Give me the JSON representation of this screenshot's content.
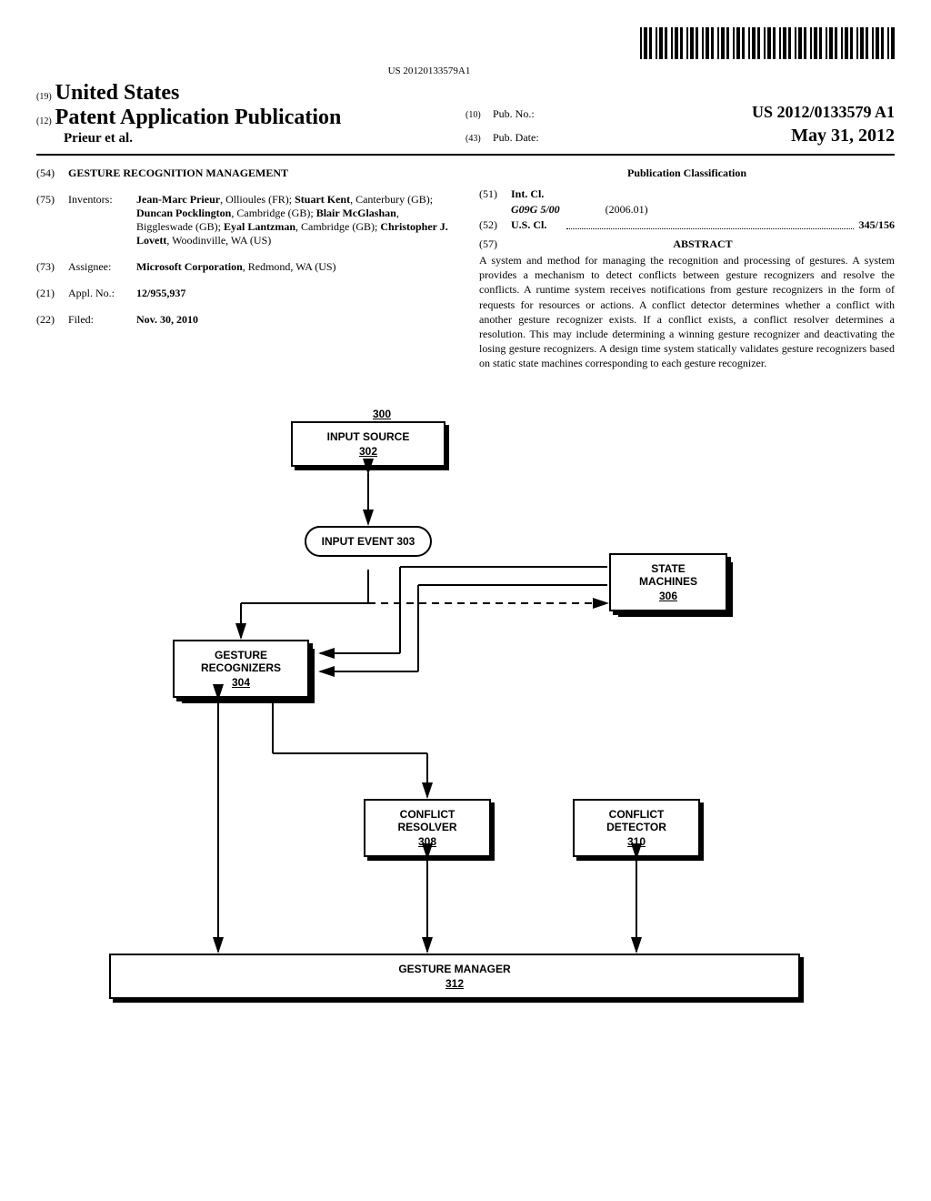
{
  "barcode_text": "US 20120133579A1",
  "header": {
    "num19": "(19)",
    "country": "United States",
    "num12": "(12)",
    "pub_type_label": "Patent Application Publication",
    "author_line": "Prieur et al.",
    "num10": "(10)",
    "pub_no_label": "Pub. No.:",
    "pub_no": "US 2012/0133579 A1",
    "num43": "(43)",
    "pub_date_label": "Pub. Date:",
    "pub_date": "May 31, 2012"
  },
  "biblio": {
    "num54": "(54)",
    "title": "GESTURE RECOGNITION MANAGEMENT",
    "num75": "(75)",
    "inventors_label": "Inventors:",
    "inventors": [
      {
        "name": "Jean-Marc Prieur",
        "loc": ", Ollioules (FR);"
      },
      {
        "name": "Stuart Kent",
        "loc": ", Canterbury (GB);"
      },
      {
        "name": "Duncan Pocklington",
        "loc": ", Cambridge (GB);"
      },
      {
        "name": "Blair McGlashan",
        "loc": ", Biggleswade (GB);"
      },
      {
        "name": "Eyal Lantzman",
        "loc": ", Cambridge (GB);"
      },
      {
        "name": "Christopher J. Lovett",
        "loc": ", Woodinville, WA (US)"
      }
    ],
    "num73": "(73)",
    "assignee_label": "Assignee:",
    "assignee": "Microsoft Corporation",
    "assignee_loc": ", Redmond, WA (US)",
    "num21": "(21)",
    "appl_no_label": "Appl. No.:",
    "appl_no": "12/955,937",
    "num22": "(22)",
    "filed_label": "Filed:",
    "filed_date": "Nov. 30, 2010"
  },
  "classification": {
    "header": "Publication Classification",
    "num51": "(51)",
    "int_cl_label": "Int. Cl.",
    "int_cl_code": "G09G 5/00",
    "int_cl_year": "(2006.01)",
    "num52": "(52)",
    "us_cl_label": "U.S. Cl.",
    "us_cl_code": "345/156",
    "num57": "(57)",
    "abstract_label": "ABSTRACT",
    "abstract_text": "A system and method for managing the recognition and processing of gestures. A system provides a mechanism to detect conflicts between gesture recognizers and resolve the conflicts. A runtime system receives notifications from gesture recognizers in the form of requests for resources or actions. A conflict detector determines whether a conflict with another gesture recognizer exists. If a conflict exists, a conflict resolver determines a resolution. This may include determining a winning gesture recognizer and deactivating the losing gesture recognizers. A design time system statically validates gesture recognizers based on static state machines corresponding to each gesture recognizer."
  },
  "diagram": {
    "ref300": "300",
    "input_source": "INPUT SOURCE",
    "ref302": "302",
    "input_event": "INPUT EVENT",
    "ref303": "303",
    "gesture_recognizers": "GESTURE RECOGNIZERS",
    "ref304": "304",
    "state_machines": "STATE MACHINES",
    "ref306": "306",
    "conflict_resolver": "CONFLICT RESOLVER",
    "ref308": "308",
    "conflict_detector": "CONFLICT DETECTOR",
    "ref310": "310",
    "gesture_manager": "GESTURE MANAGER",
    "ref312": "312"
  }
}
